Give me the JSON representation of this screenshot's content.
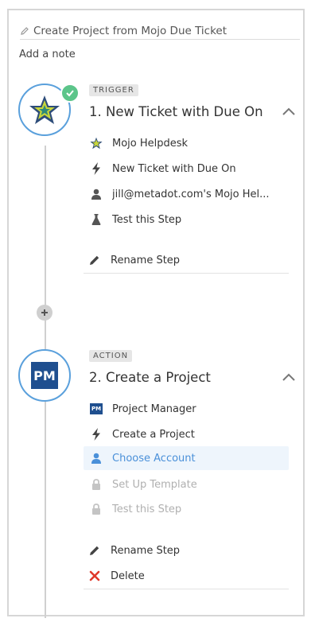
{
  "header": {
    "title": "Create Project from Mojo Due Ticket",
    "add_note": "Add a note"
  },
  "colors": {
    "accent_blue": "#5aa0dc",
    "success_green": "#5cc58a",
    "delete_red": "#e0392b",
    "pm_brand": "#1f4f8f"
  },
  "steps": [
    {
      "badge": "TRIGGER",
      "title": "1. New Ticket with Due On",
      "app_icon": "mojo-helpdesk-star-icon",
      "status": "complete",
      "items": [
        {
          "icon": "mojo-helpdesk-icon",
          "label": "Mojo Helpdesk",
          "state": "normal"
        },
        {
          "icon": "bolt-icon",
          "label": "New Ticket with Due On",
          "state": "normal"
        },
        {
          "icon": "user-icon",
          "label": "jill@metadot.com's Mojo Hel...",
          "state": "normal"
        },
        {
          "icon": "flask-icon",
          "label": "Test this Step",
          "state": "normal"
        }
      ],
      "actions": [
        {
          "icon": "pencil-icon",
          "label": "Rename Step"
        }
      ]
    },
    {
      "badge": "ACTION",
      "title": "2. Create a Project",
      "app_icon": "project-manager-icon",
      "app_icon_text": "PM",
      "items": [
        {
          "icon": "project-manager-icon",
          "label": "Project Manager",
          "state": "normal",
          "icon_text": "PM"
        },
        {
          "icon": "bolt-icon",
          "label": "Create a Project",
          "state": "normal"
        },
        {
          "icon": "user-icon",
          "label": "Choose Account",
          "state": "active"
        },
        {
          "icon": "lock-icon",
          "label": "Set Up Template",
          "state": "disabled"
        },
        {
          "icon": "lock-icon",
          "label": "Test this Step",
          "state": "disabled"
        }
      ],
      "actions": [
        {
          "icon": "pencil-icon",
          "label": "Rename Step"
        },
        {
          "icon": "delete-x-icon",
          "label": "Delete"
        }
      ]
    }
  ]
}
